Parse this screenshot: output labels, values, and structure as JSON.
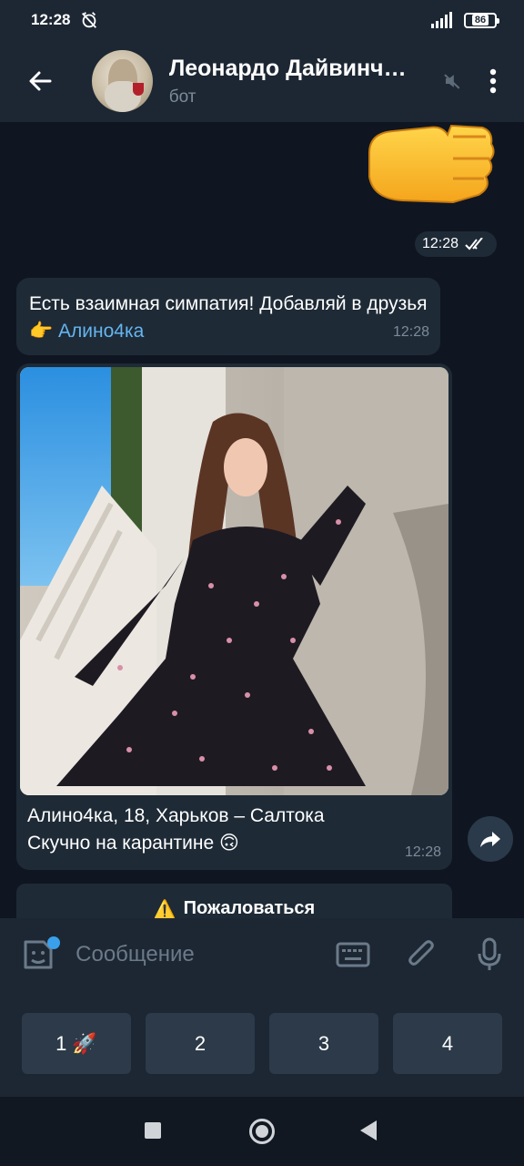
{
  "status_bar": {
    "time": "12:28",
    "battery": "86"
  },
  "header": {
    "title": "Леонардо Дайвинч…",
    "subtitle": "бот"
  },
  "chat": {
    "sticker_time": "12:28",
    "message1": {
      "text_before": "Есть взаимная симпатия! Добавляй в друзья ",
      "emoji": "👉",
      "link": "Алино4ка",
      "time": "12:28"
    },
    "message2": {
      "caption_line1": "Алино4ка, 18, Харьков – Салтока",
      "caption_line2": "Скучно на карантине",
      "caption_emoji": "🙃",
      "time": "12:28"
    },
    "report_button": {
      "icon": "⚠️",
      "label": "Пожаловаться"
    }
  },
  "composer": {
    "placeholder": "Сообщение"
  },
  "keyboard": {
    "buttons": [
      {
        "label": "1",
        "emoji": "🚀"
      },
      {
        "label": "2"
      },
      {
        "label": "3"
      },
      {
        "label": "4"
      }
    ]
  },
  "colors": {
    "header_bg": "#1d2733",
    "chat_bg": "#0f1621",
    "bubble_bg": "#1e2a36",
    "link": "#64b5ef",
    "accent_dot": "#3aa0ec"
  },
  "icons": [
    "back-arrow-icon",
    "mute-icon",
    "more-vert-icon",
    "emoji-icon",
    "keyboard-icon",
    "attach-icon",
    "mic-icon",
    "share-icon"
  ]
}
